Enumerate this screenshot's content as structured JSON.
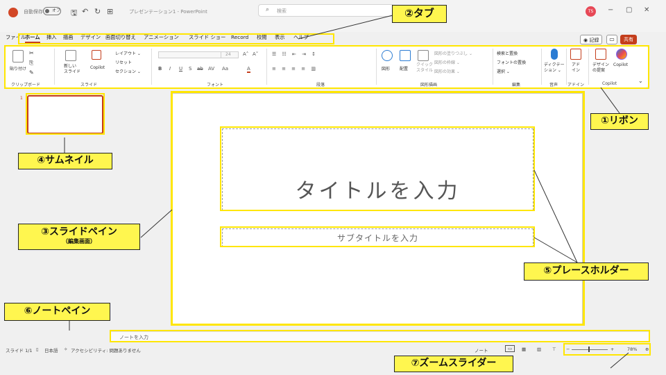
{
  "titlebar": {
    "autosave_label": "自動保存",
    "autosave_state": "オフ",
    "doc_title": "プレゼンテーション1 - PowerPoint",
    "search_placeholder": "検索",
    "avatar_initials": "TS",
    "minimize": "−",
    "maximize": "▢",
    "close": "✕"
  },
  "tabs": [
    "ファイル",
    "ホーム",
    "挿入",
    "描画",
    "デザイン",
    "画面切り替え",
    "アニメーション",
    "スライド ショー",
    "Record",
    "校閲",
    "表示",
    "ヘルプ"
  ],
  "tab_actions": {
    "record": "◉ 記録",
    "comment": "▭",
    "share": "共有"
  },
  "ribbon": {
    "clipboard": {
      "paste": "貼り付け",
      "group": "クリップボード"
    },
    "slides": {
      "new_slide": "新しい\nスライド",
      "copilot": "Copilot",
      "layout": "レイアウト ⌄",
      "reset": "リセット",
      "section": "セクション ⌄",
      "group": "スライド"
    },
    "font": {
      "size": "24",
      "group": "フォント",
      "buttons": [
        "B",
        "I",
        "U",
        "S",
        "ab",
        "AV",
        "Aa",
        "A"
      ]
    },
    "paragraph": {
      "group": "段落"
    },
    "drawing": {
      "shapes": "図形",
      "arrange": "配置",
      "quick_styles": "クイック\nスタイル",
      "fill": "図形の塗りつぶし ⌄",
      "outline": "図形の枠線 ⌄",
      "effects": "図形の効果 ⌄",
      "group": "図形描画"
    },
    "editing": {
      "find_replace": "検索と置換",
      "replace_font": "フォントの置換",
      "select": "選択 ⌄",
      "group": "編集"
    },
    "voice": {
      "dictate": "ディクテー\nション ⌄",
      "group": "音声"
    },
    "addins": {
      "label": "アド\nイン",
      "group": "アドイン"
    },
    "copilot": {
      "designer": "デザイン\nの提案",
      "copilot": "Copilot",
      "group": "Copilot"
    }
  },
  "thumbnails": [
    {
      "number": "1"
    }
  ],
  "slide": {
    "title_placeholder": "タイトルを入力",
    "subtitle_placeholder": "サブタイトルを入力"
  },
  "notes": {
    "placeholder": "ノートを入力"
  },
  "statusbar": {
    "slide_count": "スライド 1/1",
    "language": "日本語",
    "accessibility": "アクセシビリティ: 問題ありません",
    "notes_btn": "ノート",
    "zoom": "78%"
  },
  "annotations": {
    "ribbon": "①リボン",
    "tabs": "②タブ",
    "slide_pane": "③スライドペイン",
    "slide_pane_sub": "（編集画面）",
    "thumbnail": "④サムネイル",
    "placeholder": "⑤プレースホルダー",
    "notes_pane": "⑥ノートペイン",
    "zoom_slider": "⑦ズームスライダー"
  },
  "colors": {
    "accent": "#c43e1c",
    "highlight": "#ffe600",
    "callout_fill": "#fff64f"
  }
}
